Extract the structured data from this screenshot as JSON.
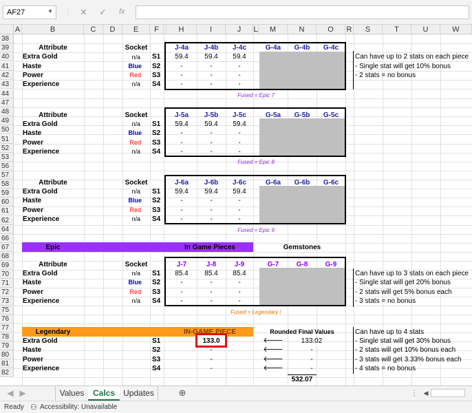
{
  "namebox": "AF27",
  "formula_icons": {
    "cancel": "✕",
    "enter": "✓",
    "fx": "fx"
  },
  "columns": [
    "A",
    "B",
    "C",
    "D",
    "E",
    "F",
    "H",
    "I",
    "J",
    "L",
    "M",
    "N",
    "O",
    "R",
    "S",
    "T",
    "U",
    "W"
  ],
  "rows": [
    "38",
    "39",
    "40",
    "41",
    "42",
    "43",
    "44",
    "47",
    "48",
    "49",
    "50",
    "51",
    "52",
    "53",
    "56",
    "57",
    "58",
    "59",
    "60",
    "61",
    "62",
    "64",
    "66",
    "67",
    "68",
    "69",
    "70",
    "71",
    "72",
    "73",
    "75",
    "76",
    "77",
    "78",
    "79",
    "80",
    "81",
    "82"
  ],
  "labels": {
    "attribute": "Attribute",
    "socket": "Socket",
    "extra_gold": "Extra Gold",
    "haste": "Haste",
    "power": "Power",
    "experience": "Experience",
    "na": "n/a",
    "blue": "Blue",
    "red": "Red",
    "s1": "S1",
    "s2": "S2",
    "s3": "S3",
    "s4": "S4",
    "dash": "-"
  },
  "block7": {
    "h": [
      "J-4a",
      "J-4b",
      "J-4c",
      "G-4a",
      "G-4b",
      "G-4c"
    ],
    "v": [
      "59.4",
      "59.4",
      "59.4"
    ],
    "fused": "Fused = Epic 7"
  },
  "block8": {
    "h": [
      "J-5a",
      "J-5b",
      "J-5c",
      "G-5a",
      "G-5b",
      "G-5c"
    ],
    "v": [
      "59.4",
      "59.4",
      "59.4"
    ],
    "fused": "Fused = Epic 8"
  },
  "block9": {
    "h": [
      "J-6a",
      "J-6b",
      "J-6c",
      "G-6a",
      "G-6b",
      "G-6c"
    ],
    "v": [
      "59.4",
      "59.4",
      "59.4"
    ],
    "fused": "Fused = Epic 9"
  },
  "epic": {
    "title": "Epic",
    "in_game": "In Game Pieces",
    "gemstones": "Gemstones",
    "h": [
      "J-7",
      "J-8",
      "J-9",
      "G-7",
      "G-8",
      "G-9"
    ],
    "v": [
      "85.4",
      "85.4",
      "85.4"
    ],
    "fused": "Fused = Legendary !"
  },
  "legendary": {
    "title": "Legendary",
    "in_game": "IN-GAME  PIECE",
    "rounded": "Rounded Final Values",
    "piece_value": "133.0",
    "arrow": "🡐",
    "final_values": [
      "133.02",
      "-",
      "-",
      "-"
    ],
    "total": "532.07"
  },
  "notes": {
    "n1": [
      "Can have up to 2 stats on each piece",
      "- Single stat will get 10% bonus",
      "- 2 stats = no bonus"
    ],
    "n2": [
      "Can have up to 3 stats on each piece",
      "- Single stat will get 20% bonus",
      "- 2 stats will get 5% bonus each",
      "- 3 stats = no bonus"
    ],
    "n3": [
      "Can have up to 4 stats",
      "- Single stat will get 30% bonus",
      "- 2 stats will get 10% bonus each",
      "- 3 stats will get 3.33% bonus each",
      "- 4 stats = no bonus"
    ]
  },
  "tabs": [
    "Values",
    "Calcs",
    "Updates"
  ],
  "status": {
    "ready": "Ready",
    "accessibility": "Accessibility: Unavailable"
  },
  "colors": {
    "purple": "#9b30ff",
    "orange": "#ff9a1a",
    "gray_fill": "#bfbfbf",
    "highlight": "#e01010",
    "active_tab": "#1e7145"
  }
}
